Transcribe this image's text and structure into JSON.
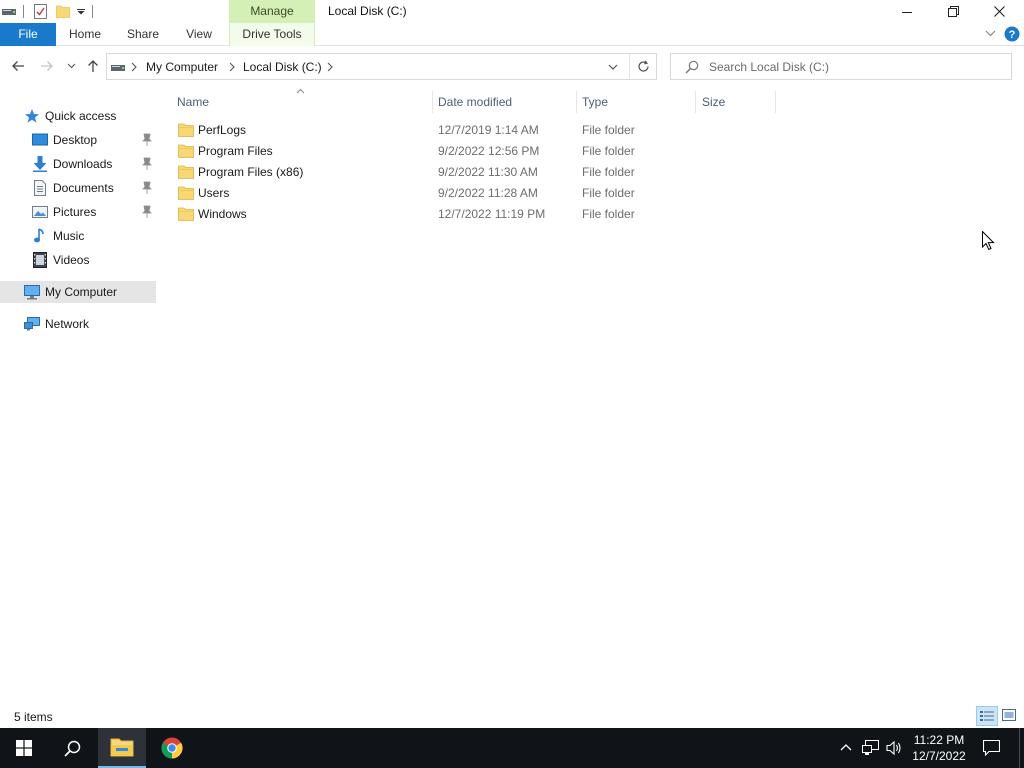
{
  "window": {
    "title": "Local Disk (C:)",
    "contextual_tab": "Manage"
  },
  "ribbon": {
    "tabs": [
      {
        "label": "File"
      },
      {
        "label": "Home"
      },
      {
        "label": "Share"
      },
      {
        "label": "View"
      },
      {
        "label": "Drive Tools"
      }
    ]
  },
  "address": {
    "crumbs": [
      "My Computer",
      "Local Disk (C:)"
    ],
    "search_placeholder": "Search Local Disk (C:)"
  },
  "navpane": {
    "items": [
      {
        "label": "Quick access",
        "icon": "star-icon",
        "pinned": false
      },
      {
        "label": "Desktop",
        "icon": "desktop-icon",
        "pinned": true
      },
      {
        "label": "Downloads",
        "icon": "download-icon",
        "pinned": true
      },
      {
        "label": "Documents",
        "icon": "documents-icon",
        "pinned": true
      },
      {
        "label": "Pictures",
        "icon": "pictures-icon",
        "pinned": true
      },
      {
        "label": "Music",
        "icon": "music-icon",
        "pinned": false
      },
      {
        "label": "Videos",
        "icon": "videos-icon",
        "pinned": false
      },
      {
        "label": "My Computer",
        "icon": "computer-icon",
        "selected": true
      },
      {
        "label": "Network",
        "icon": "network-icon"
      }
    ]
  },
  "filelist": {
    "columns": [
      "Name",
      "Date modified",
      "Type",
      "Size"
    ],
    "rows": [
      {
        "name": "PerfLogs",
        "date": "12/7/2019 1:14 AM",
        "type": "File folder",
        "size": ""
      },
      {
        "name": "Program Files",
        "date": "9/2/2022 12:56 PM",
        "type": "File folder",
        "size": ""
      },
      {
        "name": "Program Files (x86)",
        "date": "9/2/2022 11:30 AM",
        "type": "File folder",
        "size": ""
      },
      {
        "name": "Users",
        "date": "9/2/2022 11:28 AM",
        "type": "File folder",
        "size": ""
      },
      {
        "name": "Windows",
        "date": "12/7/2022 11:19 PM",
        "type": "File folder",
        "size": ""
      }
    ]
  },
  "status": {
    "item_count": "5 items"
  },
  "taskbar": {
    "time": "11:22 PM",
    "date": "12/7/2022"
  },
  "colors": {
    "accent": "#1979ca",
    "manage_tab": "#d5f0b6",
    "folder": "#f8d775",
    "taskbar": "#101418",
    "selection": "#e5e5e5"
  }
}
